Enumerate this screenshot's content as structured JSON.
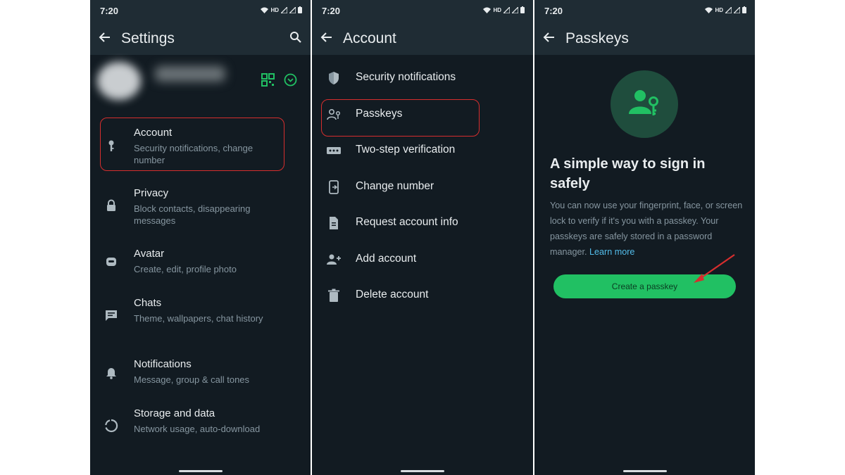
{
  "status_time": "7:20",
  "status_badge": "HD",
  "colors": {
    "background": "#121b22",
    "bar": "#1f2c34",
    "accent": "#21c063",
    "highlight_box": "#d62e2e",
    "link": "#53bdeb"
  },
  "settings_screen": {
    "title": "Settings",
    "back_icon": "arrow-left-icon",
    "search_icon": "search-icon",
    "profile_icons": [
      "qr-code-icon",
      "chevron-down-circle-icon"
    ],
    "items": [
      {
        "icon": "key-icon",
        "label": "Account",
        "sub": "Security notifications, change number"
      },
      {
        "icon": "lock-icon",
        "label": "Privacy",
        "sub": "Block contacts, disappearing messages"
      },
      {
        "icon": "avatar-icon",
        "label": "Avatar",
        "sub": "Create, edit, profile photo"
      },
      {
        "icon": "chat-icon",
        "label": "Chats",
        "sub": "Theme, wallpapers, chat history"
      },
      {
        "icon": "bell-icon",
        "label": "Notifications",
        "sub": "Message, group & call tones"
      },
      {
        "icon": "data-usage-icon",
        "label": "Storage and data",
        "sub": "Network usage, auto-download"
      }
    ]
  },
  "account_screen": {
    "title": "Account",
    "items": [
      {
        "icon": "shield-icon",
        "label": "Security notifications"
      },
      {
        "icon": "passkey-icon",
        "label": "Passkeys"
      },
      {
        "icon": "dots-icon",
        "label": "Two-step verification"
      },
      {
        "icon": "phone-change-icon",
        "label": "Change number"
      },
      {
        "icon": "document-icon",
        "label": "Request account info"
      },
      {
        "icon": "add-person-icon",
        "label": "Add account"
      },
      {
        "icon": "trash-icon",
        "label": "Delete account"
      }
    ]
  },
  "passkeys_screen": {
    "title": "Passkeys",
    "hero_icon": "person-key-icon",
    "heading": "A simple way to sign in safely",
    "body": "You can now use your fingerprint, face, or screen lock to verify if it's you with a passkey. Your passkeys are safely stored in a password manager.",
    "link": "Learn more",
    "button": "Create a passkey"
  }
}
